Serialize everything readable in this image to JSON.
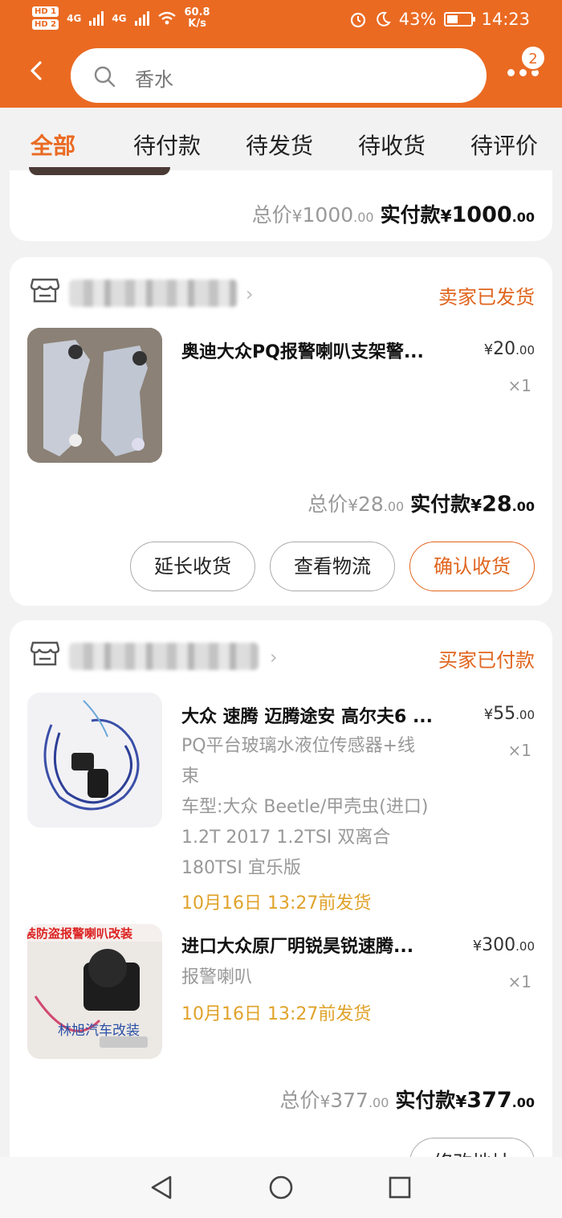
{
  "status_bar": {
    "hd1": "HD 1",
    "hd2": "HD 2",
    "sig1": "4G",
    "sig2": "4G",
    "speed": "60.8",
    "speed_unit": "K/s",
    "battery": "43%",
    "time": "14:23"
  },
  "header": {
    "search_query": "香水",
    "cart_badge": "2"
  },
  "tabs": [
    {
      "label": "全部"
    },
    {
      "label": "待付款"
    },
    {
      "label": "待发货"
    },
    {
      "label": "待收货"
    },
    {
      "label": "待评价"
    }
  ],
  "orders": [
    {
      "total_label": "总价",
      "total_int": "1000",
      "total_dec": ".00",
      "paid_label": "实付款",
      "paid_int": "1000",
      "paid_dec": ".00"
    },
    {
      "status": "卖家已发货",
      "items": [
        {
          "title": "奥迪大众PQ报警喇叭支架警...",
          "price_int": "20",
          "price_dec": ".00",
          "qty": "×1"
        }
      ],
      "total_label": "总价",
      "total_int": "28",
      "total_dec": ".00",
      "paid_label": "实付款",
      "paid_int": "28",
      "paid_dec": ".00",
      "buttons": [
        "延长收货",
        "查看物流",
        "确认收货"
      ]
    },
    {
      "status": "买家已付款",
      "items": [
        {
          "title": "大众 速腾 迈腾途安 高尔夫6 ...",
          "price_int": "55",
          "price_dec": ".00",
          "qty": "×1",
          "spec": [
            "PQ平台玻璃水液位传感器+线",
            "束",
            "车型:大众 Beetle/甲壳虫(进口)",
            "1.2T 2017 1.2TSI 双离合",
            "180TSI 宜乐版"
          ],
          "ship": "10月16日 13:27前发货"
        },
        {
          "title": "进口大众原厂明锐昊锐速腾...",
          "price_int": "300",
          "price_dec": ".00",
          "qty": "×1",
          "spec": [
            "报警喇叭"
          ],
          "ship": "10月16日 13:27前发货",
          "image_text": [
            "装防盗报警喇叭改装",
            "林旭汽车改装"
          ]
        }
      ],
      "total_label": "总价",
      "total_int": "377",
      "total_dec": ".00",
      "paid_label": "实付款",
      "paid_int": "377",
      "paid_dec": ".00",
      "buttons": [
        "修改地址"
      ]
    }
  ],
  "currency": "¥",
  "colors": {
    "brand": "#ea6a22",
    "status": "#e0651e",
    "ship": "#e0a22a"
  }
}
